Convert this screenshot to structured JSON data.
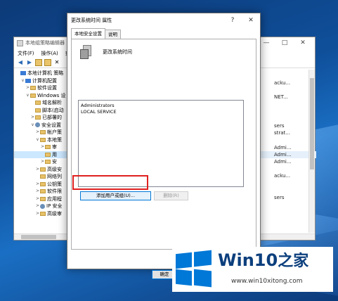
{
  "gpe": {
    "title": "本地组策略编辑器",
    "window_controls": [
      "—",
      "□",
      "✕"
    ],
    "menu": [
      "文件(F)",
      "操作(A)",
      "查"
    ],
    "tree": [
      {
        "label": "本地计算机 策略",
        "indent": 0,
        "icon": "computer-icon",
        "toggle": ""
      },
      {
        "label": "计算机配置",
        "indent": 1,
        "icon": "computer-icon",
        "toggle": "∨"
      },
      {
        "label": "软件设置",
        "indent": 2,
        "icon": "folder-icon",
        "toggle": ">"
      },
      {
        "label": "Windows 设",
        "indent": 2,
        "icon": "folder-icon",
        "toggle": "∨"
      },
      {
        "label": "域名解析",
        "indent": 3,
        "icon": "folder-icon",
        "toggle": ""
      },
      {
        "label": "脚本(启动",
        "indent": 3,
        "icon": "folder-icon",
        "toggle": ""
      },
      {
        "label": "已部署的",
        "indent": 3,
        "icon": "folder-icon",
        "toggle": ">"
      },
      {
        "label": "安全设置",
        "indent": 3,
        "icon": "gear-icon",
        "toggle": "∨"
      },
      {
        "label": "帐户策",
        "indent": 4,
        "icon": "folder-icon",
        "toggle": ">"
      },
      {
        "label": "本地策",
        "indent": 4,
        "icon": "folder-icon",
        "toggle": "∨"
      },
      {
        "label": "审",
        "indent": 5,
        "icon": "folder-icon",
        "toggle": ">"
      },
      {
        "label": "用",
        "indent": 5,
        "icon": "folder-icon",
        "toggle": "",
        "selected": true
      },
      {
        "label": "安",
        "indent": 5,
        "icon": "folder-icon",
        "toggle": ">"
      },
      {
        "label": "高级安",
        "indent": 4,
        "icon": "folder-icon",
        "toggle": ">"
      },
      {
        "label": "网络列",
        "indent": 4,
        "icon": "folder-icon",
        "toggle": ""
      },
      {
        "label": "公钥策",
        "indent": 4,
        "icon": "folder-icon",
        "toggle": ">"
      },
      {
        "label": "软件限",
        "indent": 4,
        "icon": "folder-icon",
        "toggle": ">"
      },
      {
        "label": "应用程",
        "indent": 4,
        "icon": "folder-icon",
        "toggle": ">"
      },
      {
        "label": "IP 安全",
        "indent": 4,
        "icon": "gear-icon",
        "toggle": ">"
      },
      {
        "label": "高级审",
        "indent": 4,
        "icon": "folder-icon",
        "toggle": ">"
      }
    ],
    "right_items": [
      "acku...",
      "",
      "NET...",
      "",
      "",
      "",
      "sers",
      "strat...",
      "",
      "Admi...",
      "Admi...",
      "Admi...",
      "",
      "acku...",
      "",
      "",
      "sers"
    ]
  },
  "dialog": {
    "title": "更改系统时间 属性",
    "help": "?",
    "close": "✕",
    "tabs": [
      "本地安全设置",
      "说明"
    ],
    "policy_name": "更改系统时间",
    "accounts": [
      "Administrators",
      "LOCAL SERVICE"
    ],
    "add_button": "添加用户或组(U)...",
    "remove_button": "删除(R)",
    "ok_button": "确定"
  },
  "watermark": {
    "brand": "Win10",
    "brand_zh": "之家",
    "url": "www.win10xitong.com",
    "color": "#0078d7"
  }
}
